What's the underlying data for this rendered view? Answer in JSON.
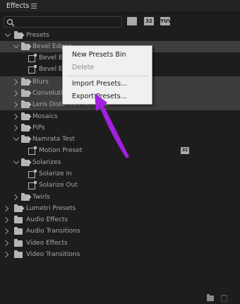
{
  "panel": {
    "title": "Effects",
    "menu_icon": "hamburger-menu-icon"
  },
  "search": {
    "value": "",
    "placeholder": ""
  },
  "filters": [
    "accelerated-effects-icon",
    "32bit-color-icon",
    "yuv-icon"
  ],
  "filter_labels": [
    "",
    "32",
    "YUV"
  ],
  "tree": {
    "presets": "Presets",
    "bevel_edges": "Bevel Edges",
    "bevel_1": "Bevel Edges Thick",
    "bevel_2": "Bevel Edges Thin",
    "blurs": "Blurs",
    "convolution": "Convolution Kernel",
    "lens": "Lens Distortion Removal",
    "mosaics": "Mosaics",
    "pips": "PiPs",
    "namrata": "Namrata Test",
    "motion_preset": "Motion Preset",
    "solarizes": "Solarizes",
    "solarize_in": "Solarize In",
    "solarize_out": "Solarize Out",
    "twirls": "Twirls",
    "lumetri": "Lumetri Presets",
    "audio_effects": "Audio Effects",
    "audio_transitions": "Audio Transitions",
    "video_effects": "Video Effects",
    "video_transitions": "Video Transitions"
  },
  "motion_badge": "32",
  "context_menu": {
    "new_presets_bin": "New Presets Bin",
    "delete": "Delete",
    "import_presets": "Import Presets...",
    "export_presets": "Export Presets..."
  },
  "annotation": {
    "arrow_color": "#a21fe0"
  },
  "colors": {
    "background": "#1d1d1d",
    "selected_row": "#3d3d3d",
    "menu_bg": "#f0f0f0"
  }
}
